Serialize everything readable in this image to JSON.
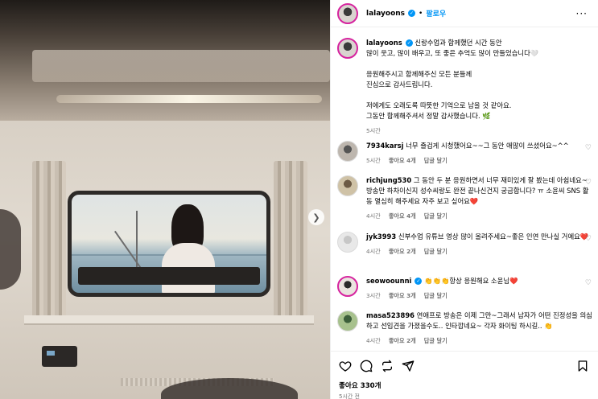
{
  "post": {
    "username": "lalayoons",
    "follow_label": "팔로우",
    "more_label": "···",
    "caption_lines": [
      "신랑수업과 함께했던 시간 동안",
      "많이 웃고, 많이 배우고, 또 좋은 추억도 많이 만들었습니다🤍",
      "",
      "응원해주시고 함께해주신 모든 분들께",
      "진심으로 감사드립니다.",
      "",
      "저에게도 오래도록 따뜻한 기억으로 남을 것 같아요.",
      "그동안 함께해주셔서 정말 감사했습니다. 🌿"
    ],
    "caption_time": "5시간",
    "likes": "좋아요 330개",
    "posted_ago": "5시간 전"
  },
  "comments": [
    {
      "user": "7934karsj",
      "text": "너무 즐겁게 시청했어요~~그 동안 애많이 쓰셨어요~^^",
      "time": "5시간",
      "likes": "좋아요 4개",
      "reply": "답글 달기"
    },
    {
      "user": "richjung530",
      "text": "그 동안 두 분 응원하면서 너무 재미있게 잘 봤는데 아쉽네요~ 방송만 하차이신지 성수씨랑도 완전 끝나신건지 궁금합니다? ㅠ 소윤씨 SNS 활동 열심히 해주세요 자주 보고 싶어요❤️",
      "time": "4시간",
      "likes": "좋아요 4개",
      "reply": "답글 달기"
    },
    {
      "user": "jyk3993",
      "text": "신부수업 유튜브 영상 많이 올려주세요~좋은 인연 만나실 거예요❤️",
      "time": "4시간",
      "likes": "좋아요 2개",
      "reply": "답글 달기"
    },
    {
      "user": "seowoounni",
      "text": "👏👏👏항상 응원해요 소윤님❤️",
      "time": "3시간",
      "likes": "좋아요 3개",
      "reply": "답글 달기"
    },
    {
      "user": "masa523896",
      "text": "연애프로 방송은 이제 그만~그래서 남자가 어떤 진정성을 의심하고 선입견을 가졌을수도.. 인타깝네요~ 각자 화이팅 하시길.. 👏",
      "time": "4시간",
      "likes": "좋아요 2개",
      "reply": "답글 달기"
    }
  ],
  "icons": {
    "verified": "verified-badge-icon",
    "like": "heart-icon",
    "comment": "comment-icon",
    "share": "share-icon",
    "save": "bookmark-icon",
    "next": "chevron-right-icon"
  },
  "colors": {
    "accent": "#0095f6",
    "ring": "#d6249f",
    "muted": "#737373"
  }
}
